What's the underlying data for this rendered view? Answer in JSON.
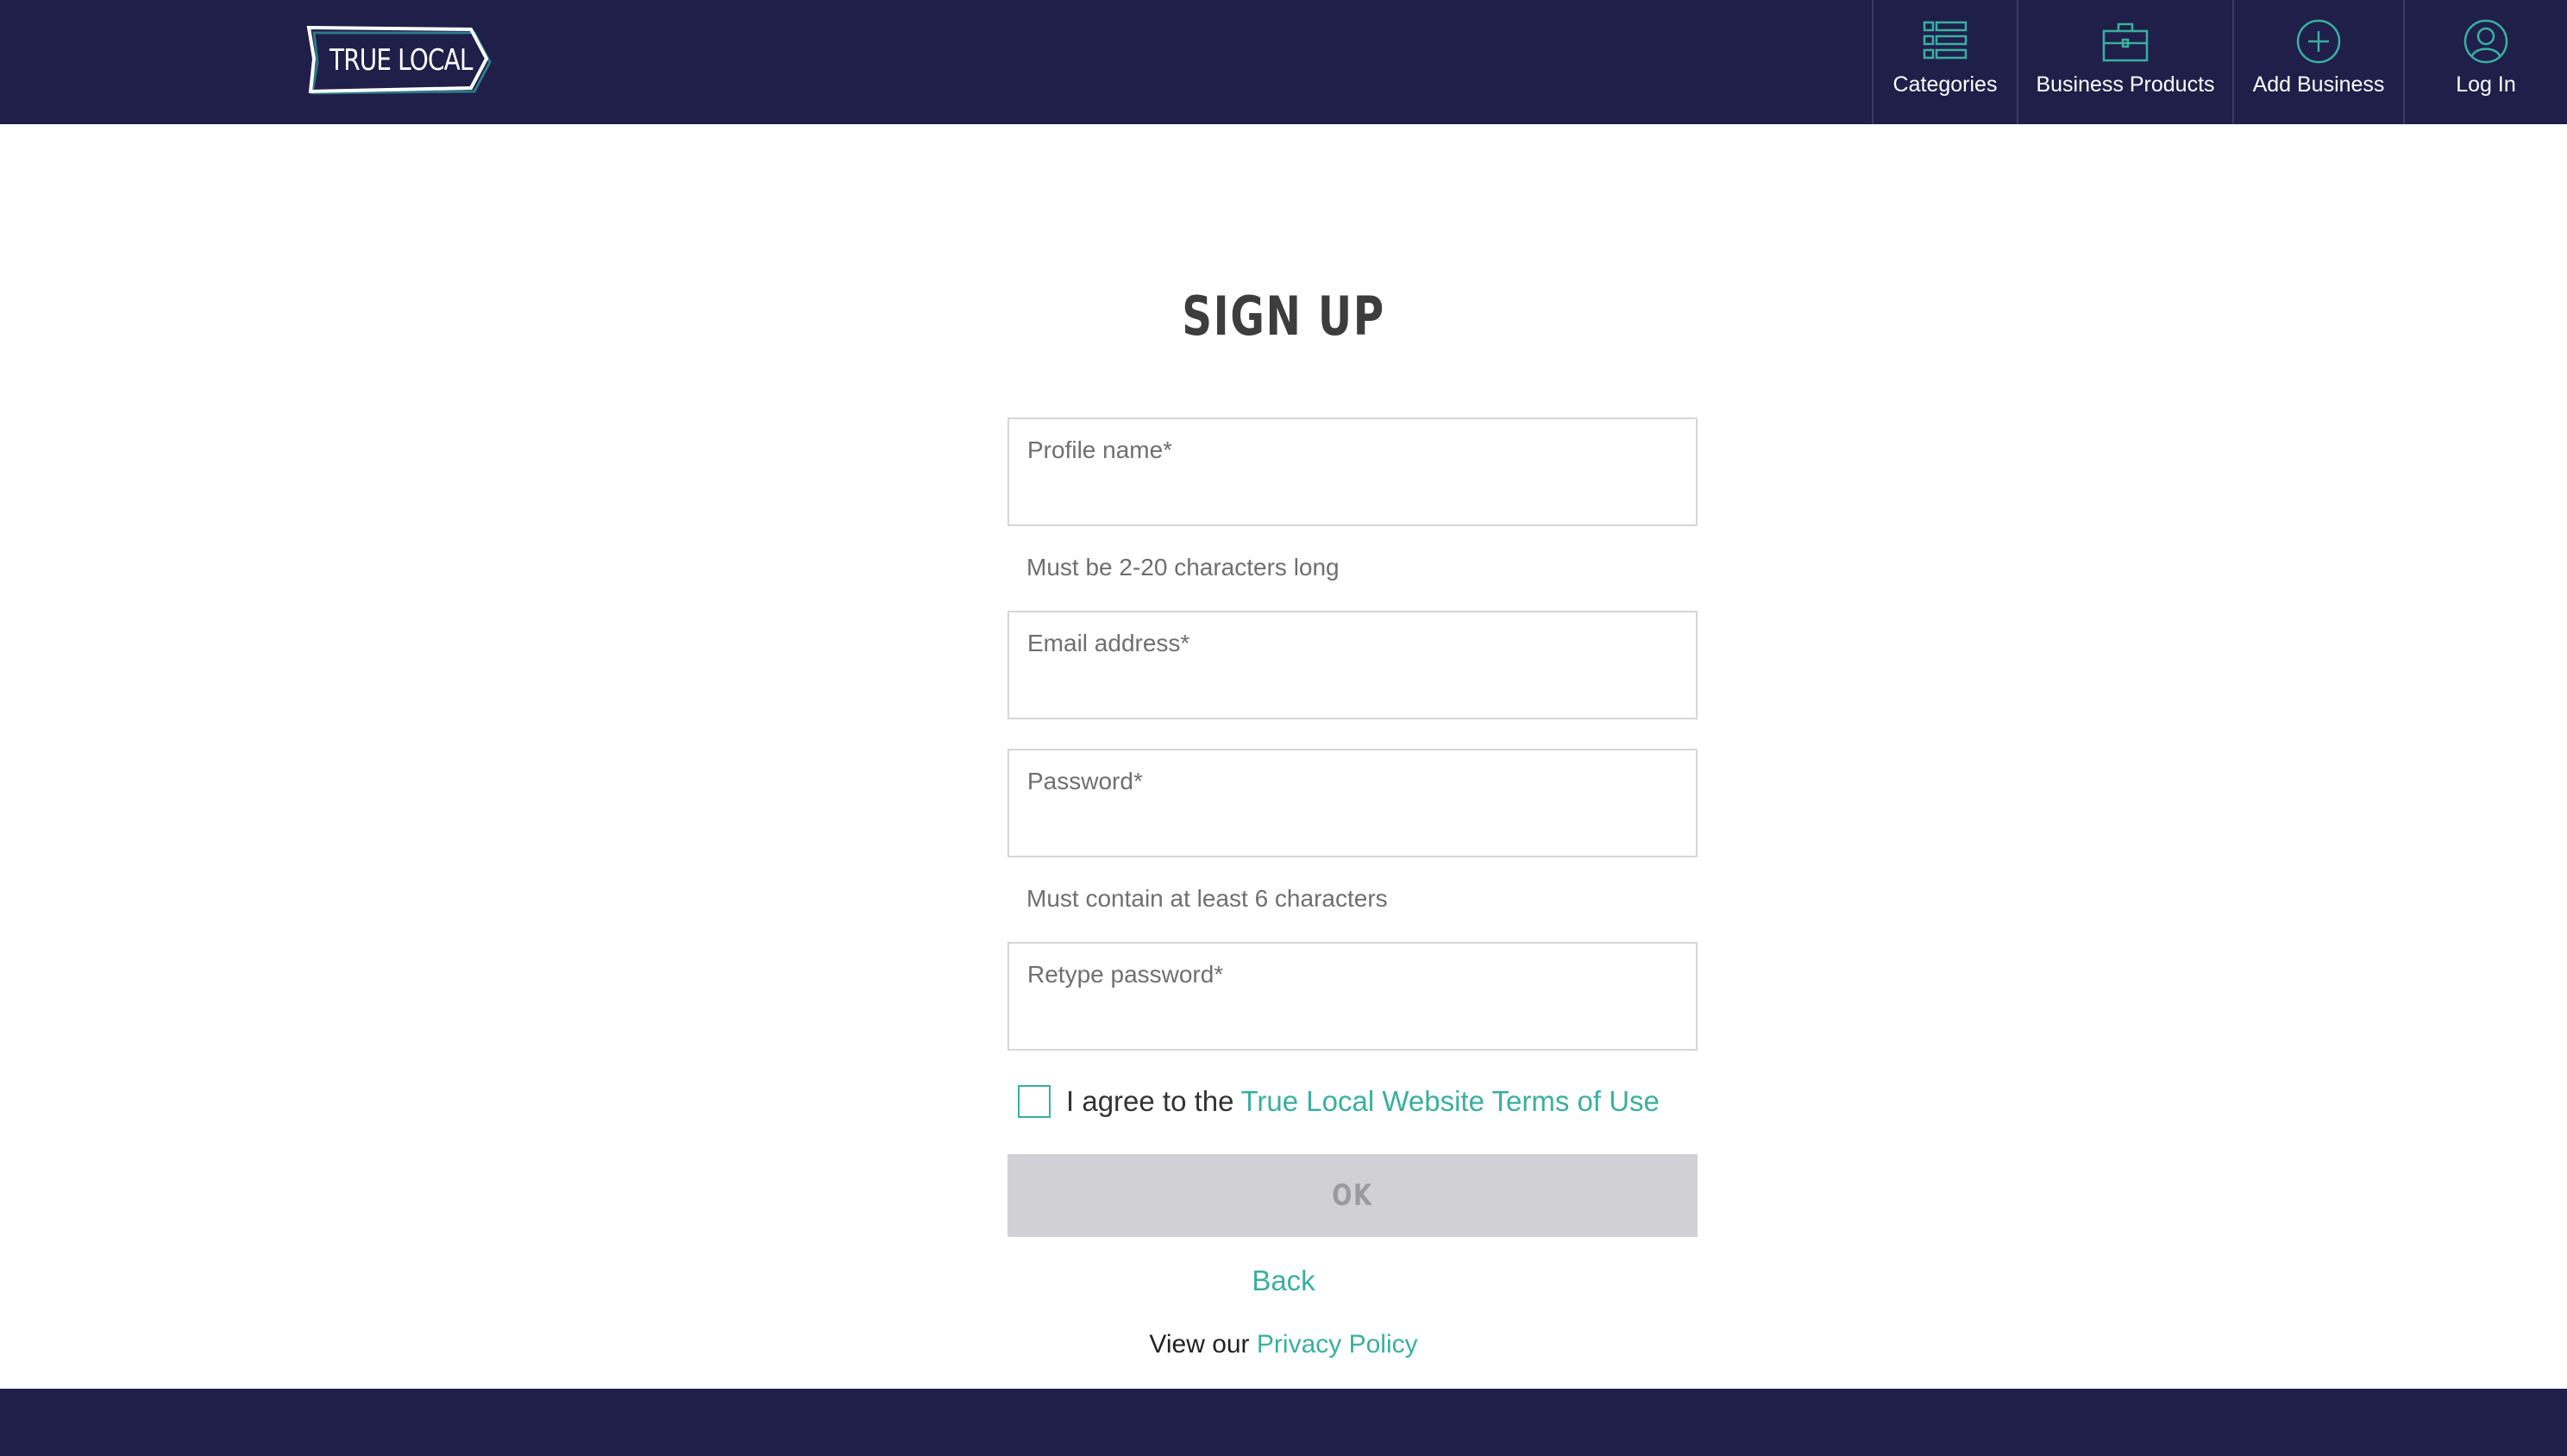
{
  "header": {
    "logo_text": "TRUE LOCAL",
    "nav": [
      {
        "label": "Categories",
        "icon": "categories-list-icon"
      },
      {
        "label": "Business Products",
        "icon": "briefcase-icon"
      },
      {
        "label": "Add Business",
        "icon": "plus-circle-icon"
      },
      {
        "label": "Log In",
        "icon": "user-circle-icon"
      }
    ]
  },
  "form": {
    "title": "SIGN UP",
    "profile_name": {
      "placeholder": "Profile name*",
      "value": "",
      "hint": "Must be 2-20 characters long"
    },
    "email": {
      "placeholder": "Email address*",
      "value": ""
    },
    "password": {
      "placeholder": "Password*",
      "value": "",
      "hint": "Must contain at least 6 characters"
    },
    "retype_password": {
      "placeholder": "Retype password*",
      "value": ""
    },
    "agree": {
      "prefix": "I agree to the",
      "link": "True Local Website Terms of Use",
      "checked": false
    },
    "ok_label": "OK",
    "back_label": "Back",
    "privacy": {
      "prefix": "View our",
      "link": "Privacy Policy"
    }
  },
  "colors": {
    "header_bg": "#1f1f4a",
    "accent": "#3aafa0",
    "button_disabled": "#d1d0d5"
  }
}
